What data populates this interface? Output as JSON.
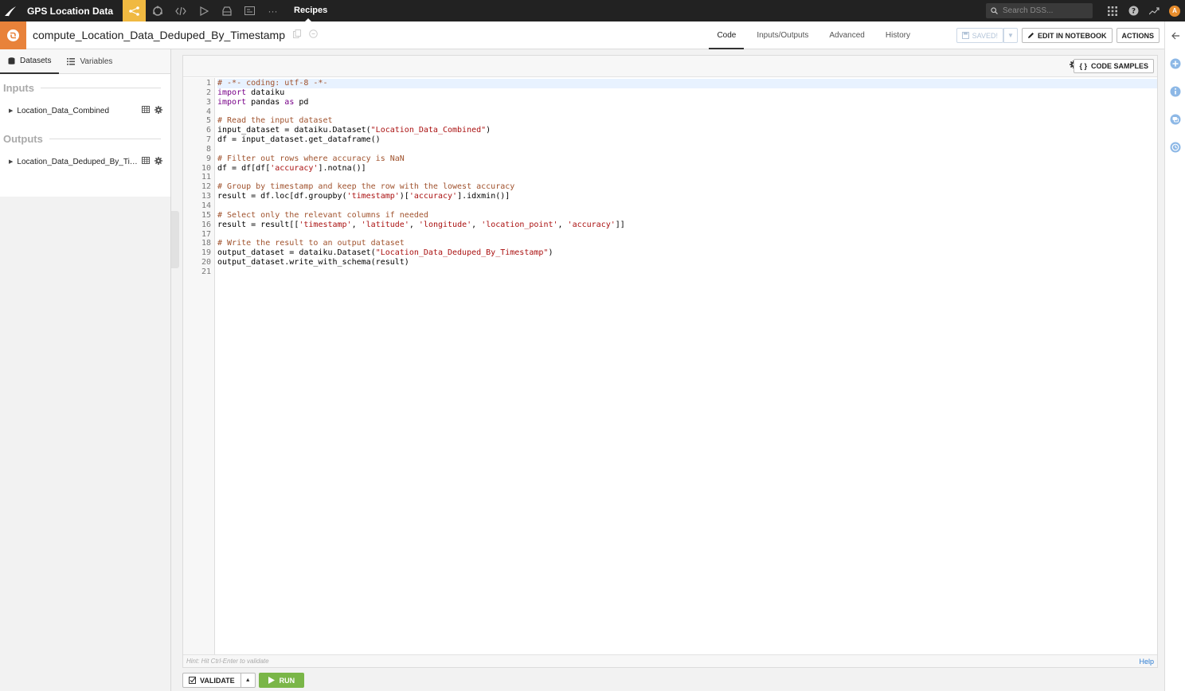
{
  "topbar": {
    "project_title": "GPS Location Data",
    "nav_icons": [
      "flow-icon",
      "refresh-icon",
      "code-icon",
      "play-icon",
      "stack-icon",
      "dashboard-icon",
      "more-icon"
    ],
    "more_label": "···",
    "current_section": "Recipes",
    "search_placeholder": "Search DSS...",
    "avatar_initial": "A"
  },
  "header": {
    "recipe_name": "compute_Location_Data_Deduped_By_Timestamp",
    "tabs": [
      {
        "label": "Code",
        "active": true
      },
      {
        "label": "Inputs/Outputs",
        "active": false
      },
      {
        "label": "Advanced",
        "active": false
      },
      {
        "label": "History",
        "active": false
      }
    ],
    "saved_label": "SAVED!",
    "edit_notebook_label": "EDIT IN NOTEBOOK",
    "actions_label": "ACTIONS"
  },
  "sidebar": {
    "tabs": [
      {
        "label": "Datasets",
        "active": true
      },
      {
        "label": "Variables",
        "active": false
      }
    ],
    "inputs_title": "Inputs",
    "inputs": [
      "Location_Data_Combined"
    ],
    "outputs_title": "Outputs",
    "outputs": [
      "Location_Data_Deduped_By_Timestamp"
    ]
  },
  "editor": {
    "code_samples_label": "CODE SAMPLES",
    "hint": "Hint: Hit Ctrl-Enter to validate",
    "help_label": "Help",
    "lines": [
      "# -*- coding: utf-8 -*-",
      "import dataiku",
      "import pandas as pd",
      "",
      "# Read the input dataset",
      "input_dataset = dataiku.Dataset(\"Location_Data_Combined\")",
      "df = input_dataset.get_dataframe()",
      "",
      "# Filter out rows where accuracy is NaN",
      "df = df[df['accuracy'].notna()]",
      "",
      "# Group by timestamp and keep the row with the lowest accuracy",
      "result = df.loc[df.groupby('timestamp')['accuracy'].idxmin()]",
      "",
      "# Select only the relevant columns if needed",
      "result = result[['timestamp', 'latitude', 'longitude', 'location_point', 'accuracy']]",
      "",
      "# Write the result to an output dataset",
      "output_dataset = dataiku.Dataset(\"Location_Data_Deduped_By_Timestamp\")",
      "output_dataset.write_with_schema(result)",
      ""
    ]
  },
  "bottom": {
    "validate_label": "VALIDATE",
    "run_label": "RUN"
  },
  "colors": {
    "topbar_bg": "#222222",
    "flow_accent": "#f0b941",
    "recipe_accent": "#e8823a",
    "run_green": "#7ab648",
    "link_blue": "#2b7bd2"
  }
}
